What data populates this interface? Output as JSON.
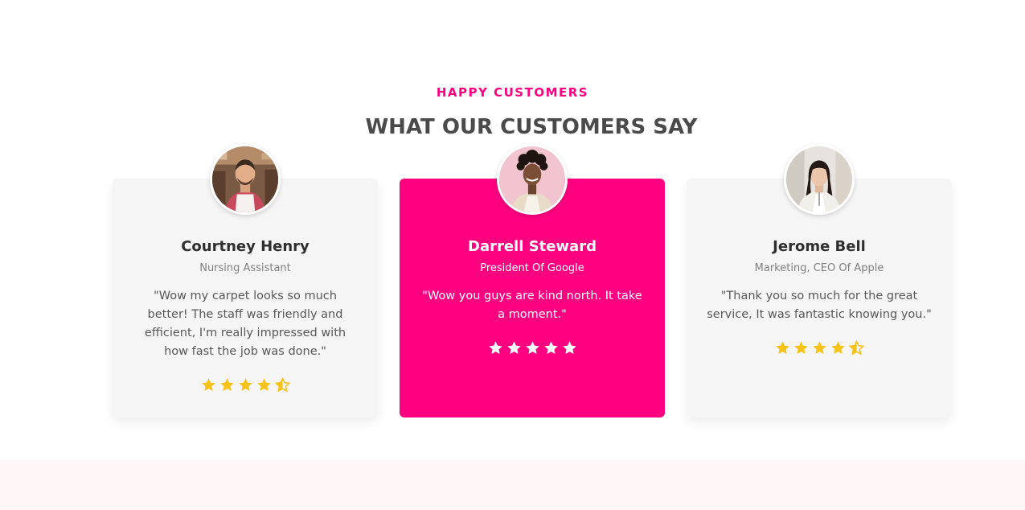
{
  "section": {
    "eyebrow": "HAPPY CUSTOMERS",
    "heading": "WHAT OUR CUSTOMERS SAY"
  },
  "colors": {
    "accent": "#ff0080",
    "star": "#f7c318",
    "card_bg": "#f5f5f5",
    "heading": "#4a4a4a"
  },
  "testimonials": [
    {
      "name": "Courtney Henry",
      "role": "Nursing Assistant",
      "quote": "\"Wow my carpet looks so much better! The staff was friendly and efficient, I'm really impressed with how fast the job was done.\"",
      "rating": 4.5,
      "featured": false,
      "avatar_icon": "man-apron-avatar"
    },
    {
      "name": "Darrell Steward",
      "role": "President Of Google",
      "quote": "\"Wow you guys are kind north. It take a moment.\"",
      "rating": 5,
      "featured": true,
      "avatar_icon": "woman-curly-hair-avatar"
    },
    {
      "name": "Jerome Bell",
      "role": "Marketing, CEO Of Apple",
      "quote": "\"Thank you so much for the great service, It was fantastic knowing you.\"",
      "rating": 4.5,
      "featured": false,
      "avatar_icon": "woman-office-avatar"
    }
  ]
}
